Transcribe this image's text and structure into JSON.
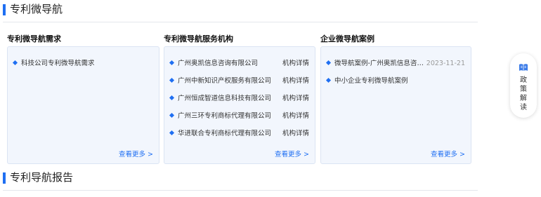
{
  "section1": {
    "title": "专利微导航"
  },
  "section2": {
    "title": "专利导航报告"
  },
  "col1": {
    "title": "专利微导航需求",
    "items": [
      "科技公司专利微导航需求"
    ],
    "more": "查看更多 >"
  },
  "col2": {
    "title": "专利微导航服务机构",
    "items": [
      {
        "name": "广州奥凯信息咨询有限公司",
        "link": "机构详情"
      },
      {
        "name": "广州中新知识产权服务有限公司",
        "link": "机构详情"
      },
      {
        "name": "广州恒成智道信息科技有限公司",
        "link": "机构详情"
      },
      {
        "name": "广州三环专利商标代理有限公司",
        "link": "机构详情"
      },
      {
        "name": "华进联合专利商标代理有限公司",
        "link": "机构详情"
      }
    ],
    "more": "查看更多 >"
  },
  "col3": {
    "title": "企业微导航案例",
    "items": [
      {
        "name": "微导航案例-广州奥凯信息咨询...",
        "date": "2023-11-21"
      },
      {
        "name": "中小企业专利微导航案例",
        "date": ""
      }
    ],
    "more": "查看更多 >"
  },
  "side": {
    "label": "政策解读",
    "icon": "book-icon"
  },
  "colors": {
    "accent": "#1f6ff2",
    "panel_bg": "#f2f6fd"
  }
}
